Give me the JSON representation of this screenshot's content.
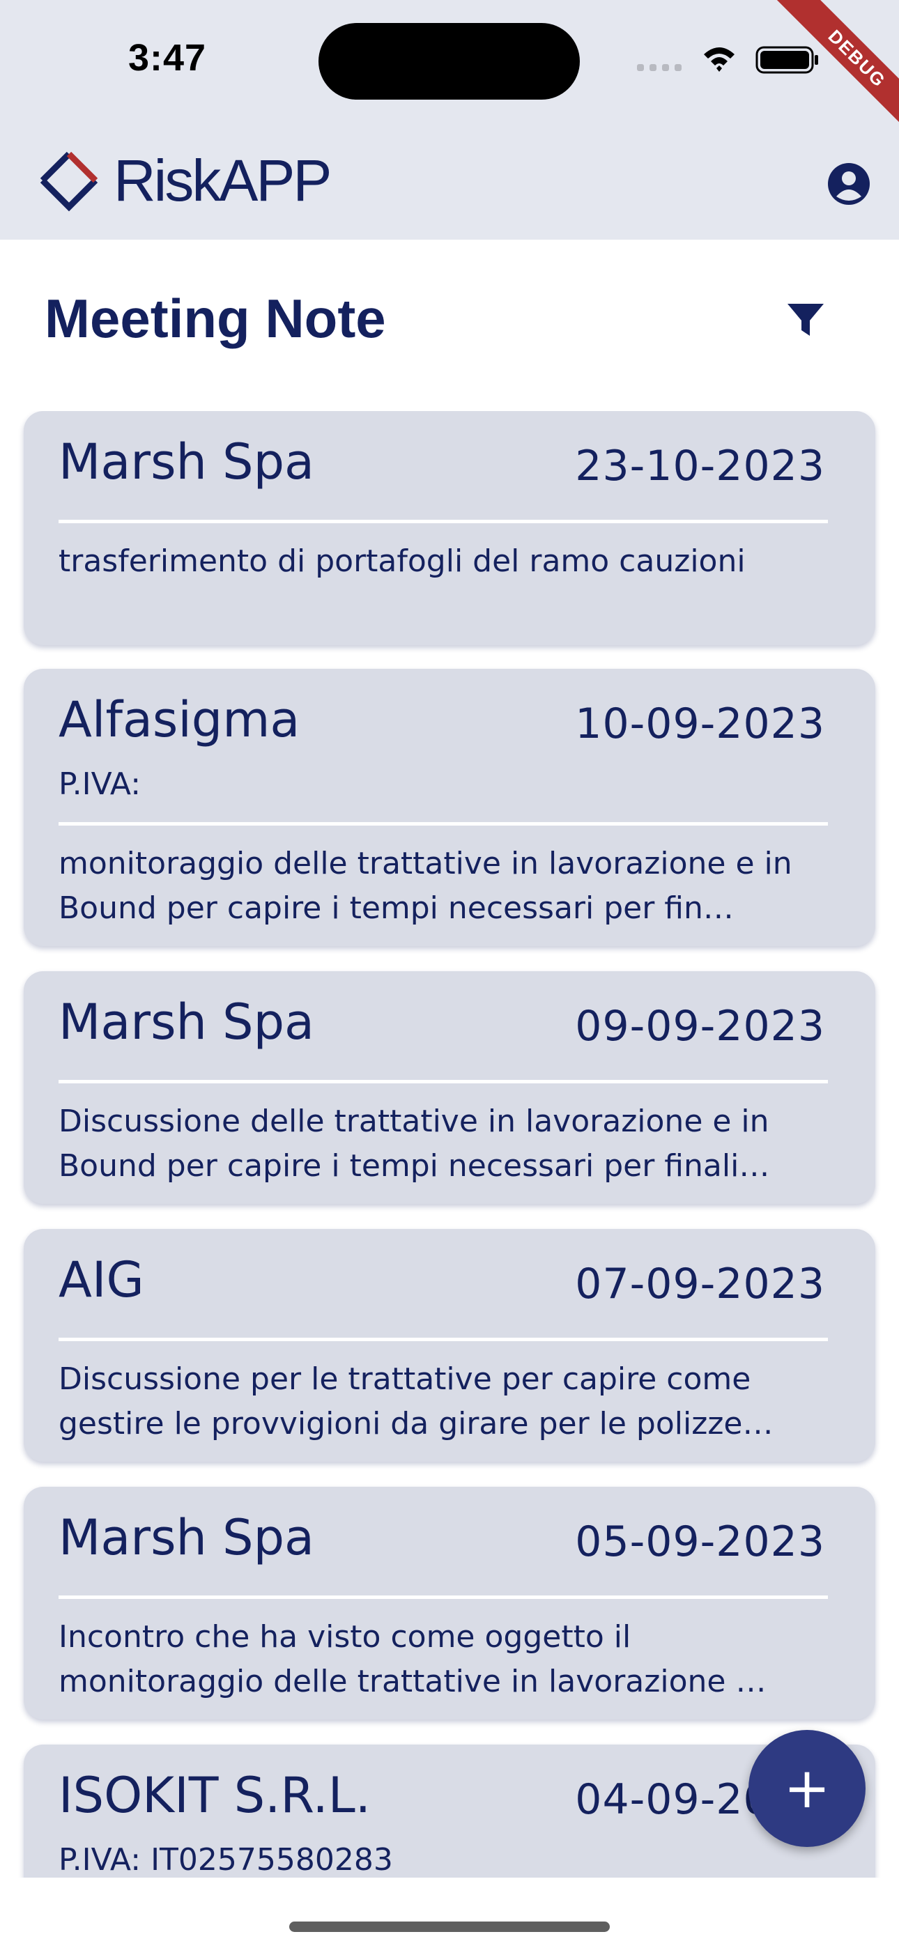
{
  "status_bar": {
    "time": "3:47"
  },
  "debug_banner": "DEBUG",
  "app_bar": {
    "brand": "RiskAPP",
    "account_icon": "account-circle-icon"
  },
  "page": {
    "title": "Meeting Note",
    "filter_icon": "filter-icon"
  },
  "notes": [
    {
      "company": "Marsh Spa",
      "date": "23-10-2023",
      "vat": "",
      "note": "trasferimento di portafogli del ramo cauzioni"
    },
    {
      "company": "Alfasigma",
      "date": "10-09-2023",
      "vat": "P.IVA:",
      "note": "monitoraggio delle trattative in lavorazione e in Bound per capire i tempi necessari per fin…"
    },
    {
      "company": "Marsh Spa",
      "date": "09-09-2023",
      "vat": "",
      "note": "Discussione delle trattative in lavorazione e in Bound per capire i tempi necessari per finali…"
    },
    {
      "company": "AIG",
      "date": "07-09-2023",
      "vat": "",
      "note": "Discussione per le trattative per capire come gestire le provvigioni da girare per le polizze…"
    },
    {
      "company": "Marsh Spa",
      "date": "05-09-2023",
      "vat": "",
      "note": "Incontro che ha visto come oggetto il monitoraggio delle trattative in lavorazione …"
    },
    {
      "company": "ISOKIT S.R.L.",
      "date": "04-09-2023",
      "vat": "P.IVA: IT02575580283",
      "note": ""
    }
  ],
  "fab": {
    "label": "+",
    "icon": "add-icon"
  },
  "colors": {
    "primary": "#14215e",
    "app_bar_bg": "#e4e7ef",
    "card_bg": "#d9dce6",
    "fab_bg": "#2e3a82",
    "logo_accent": "#b1302f",
    "debug_ribbon": "#b1302f"
  }
}
